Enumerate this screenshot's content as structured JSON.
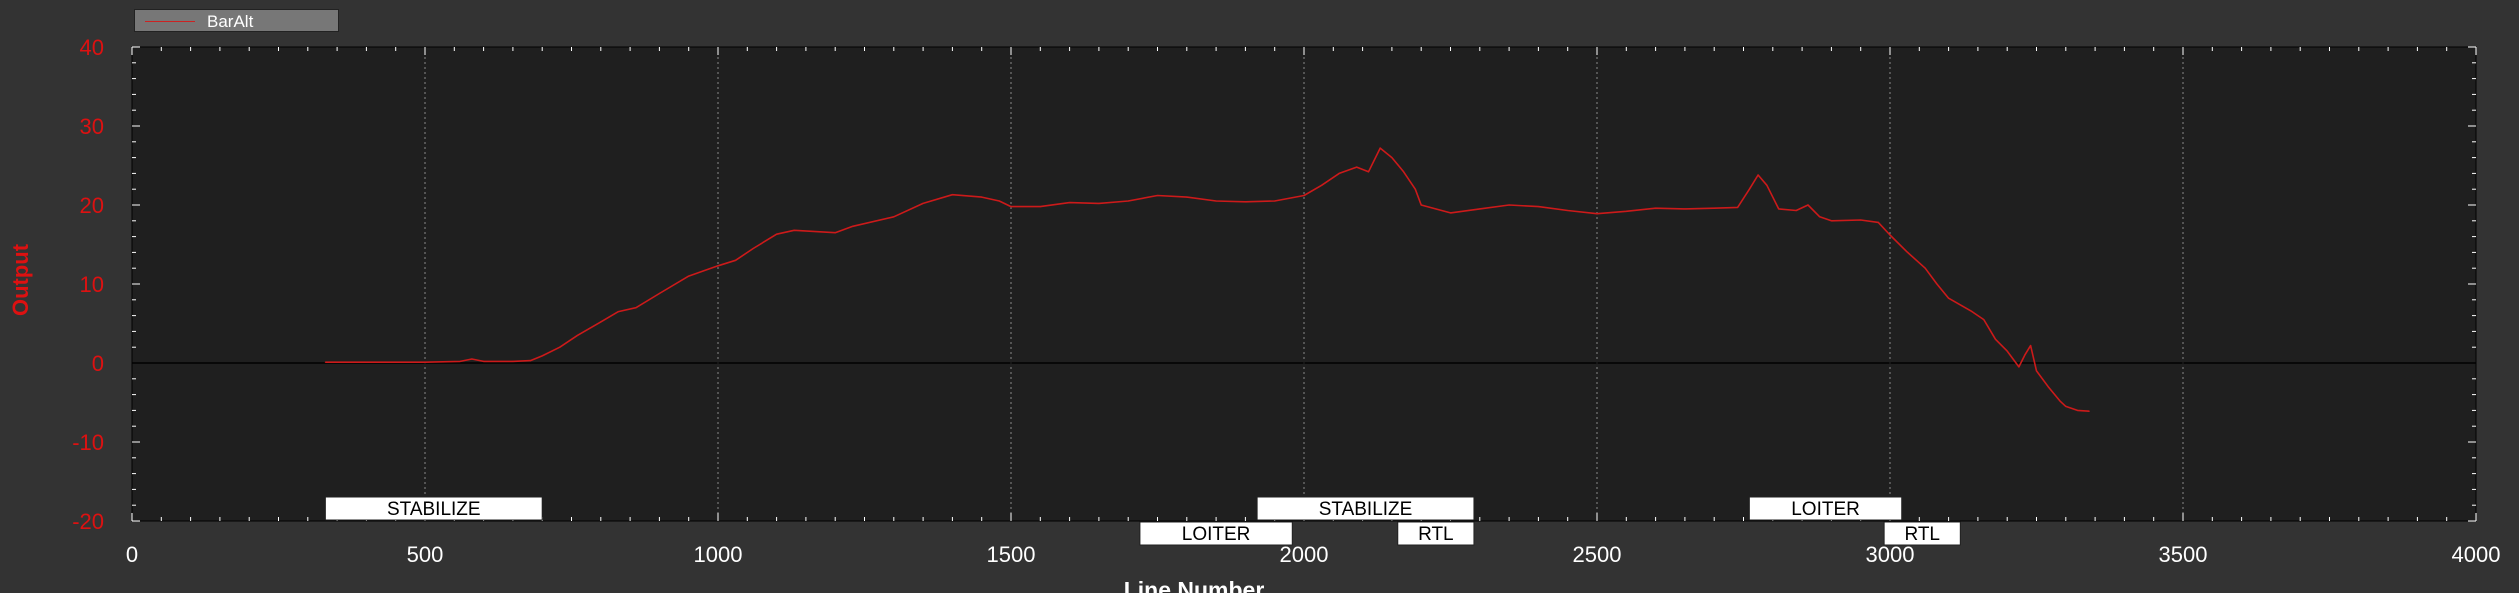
{
  "chart_data": {
    "type": "line",
    "legend": {
      "entries": [
        "BarAlt"
      ],
      "placement": "top-left"
    },
    "xlabel": "Line Number",
    "ylabel": "Output",
    "xlim": [
      0,
      4000
    ],
    "ylim": [
      -20,
      40
    ],
    "x_ticks": [
      0,
      500,
      1000,
      1500,
      2000,
      2500,
      3000,
      3500,
      4000
    ],
    "y_ticks": [
      -20,
      -10,
      0,
      10,
      20,
      30,
      40
    ],
    "grid": true,
    "series": [
      {
        "name": "BarAlt",
        "color": "#cc1a1a",
        "points": [
          [
            330,
            0.1
          ],
          [
            400,
            0.1
          ],
          [
            500,
            0.1
          ],
          [
            560,
            0.2
          ],
          [
            580,
            0.5
          ],
          [
            600,
            0.2
          ],
          [
            650,
            0.2
          ],
          [
            680,
            0.3
          ],
          [
            700,
            0.9
          ],
          [
            730,
            2.0
          ],
          [
            760,
            3.5
          ],
          [
            800,
            5.2
          ],
          [
            830,
            6.5
          ],
          [
            860,
            7.0
          ],
          [
            900,
            8.8
          ],
          [
            950,
            11.0
          ],
          [
            1000,
            12.3
          ],
          [
            1030,
            13.0
          ],
          [
            1060,
            14.5
          ],
          [
            1100,
            16.3
          ],
          [
            1130,
            16.8
          ],
          [
            1200,
            16.5
          ],
          [
            1230,
            17.3
          ],
          [
            1300,
            18.5
          ],
          [
            1350,
            20.2
          ],
          [
            1400,
            21.3
          ],
          [
            1450,
            21.0
          ],
          [
            1480,
            20.5
          ],
          [
            1500,
            19.8
          ],
          [
            1550,
            19.8
          ],
          [
            1600,
            20.3
          ],
          [
            1650,
            20.2
          ],
          [
            1700,
            20.5
          ],
          [
            1750,
            21.2
          ],
          [
            1800,
            21.0
          ],
          [
            1850,
            20.5
          ],
          [
            1900,
            20.4
          ],
          [
            1950,
            20.5
          ],
          [
            2000,
            21.2
          ],
          [
            2030,
            22.5
          ],
          [
            2060,
            24.0
          ],
          [
            2090,
            24.8
          ],
          [
            2110,
            24.2
          ],
          [
            2130,
            27.2
          ],
          [
            2150,
            26.0
          ],
          [
            2170,
            24.2
          ],
          [
            2190,
            22.0
          ],
          [
            2200,
            20.0
          ],
          [
            2250,
            19.0
          ],
          [
            2300,
            19.5
          ],
          [
            2350,
            20.0
          ],
          [
            2400,
            19.8
          ],
          [
            2450,
            19.3
          ],
          [
            2500,
            18.9
          ],
          [
            2550,
            19.2
          ],
          [
            2600,
            19.6
          ],
          [
            2650,
            19.5
          ],
          [
            2700,
            19.6
          ],
          [
            2740,
            19.7
          ],
          [
            2760,
            22.0
          ],
          [
            2775,
            23.8
          ],
          [
            2790,
            22.5
          ],
          [
            2810,
            19.5
          ],
          [
            2840,
            19.3
          ],
          [
            2860,
            20.0
          ],
          [
            2880,
            18.5
          ],
          [
            2900,
            18.0
          ],
          [
            2950,
            18.1
          ],
          [
            2980,
            17.8
          ],
          [
            3000,
            16.2
          ],
          [
            3030,
            14.0
          ],
          [
            3060,
            12.0
          ],
          [
            3080,
            10.0
          ],
          [
            3100,
            8.2
          ],
          [
            3140,
            6.5
          ],
          [
            3160,
            5.5
          ],
          [
            3180,
            3.0
          ],
          [
            3200,
            1.5
          ],
          [
            3220,
            -0.5
          ],
          [
            3230,
            1.0
          ],
          [
            3240,
            2.2
          ],
          [
            3250,
            -1.0
          ],
          [
            3270,
            -3.0
          ],
          [
            3290,
            -4.8
          ],
          [
            3300,
            -5.5
          ],
          [
            3320,
            -6.0
          ],
          [
            3340,
            -6.1
          ]
        ]
      }
    ],
    "annotations": [
      {
        "label": "STABILIZE",
        "x": 330,
        "x_end": 700,
        "row": 0
      },
      {
        "label": "LOITER",
        "x": 1720,
        "x_end": 1980,
        "row": 1
      },
      {
        "label": "STABILIZE",
        "x": 1920,
        "x_end": 2290,
        "row": 0
      },
      {
        "label": "RTL",
        "x": 2160,
        "x_end": 2290,
        "row": 1
      },
      {
        "label": "LOITER",
        "x": 2760,
        "x_end": 3020,
        "row": 0
      },
      {
        "label": "RTL",
        "x": 2990,
        "x_end": 3120,
        "row": 1
      }
    ]
  }
}
